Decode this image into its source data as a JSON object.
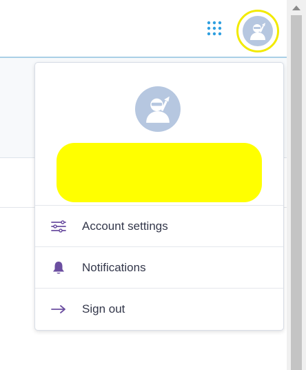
{
  "header": {
    "app_launcher_icon": "app-launcher-grid-icon",
    "avatar_icon": "user-avatar-icon"
  },
  "user_menu": {
    "avatar_icon": "user-avatar-icon",
    "menu": [
      {
        "label": "Account settings",
        "icon": "settings-list-icon"
      },
      {
        "label": "Notifications",
        "icon": "bell-icon"
      },
      {
        "label": "Sign out",
        "icon": "arrow-right-icon"
      }
    ]
  },
  "colors": {
    "accent": "#6b4ea0",
    "launcher_blue": "#2f9fe0",
    "highlight_yellow": "#f2ea00",
    "avatar_bg": "#b6c7e0",
    "header_line": "#a9cfe6"
  }
}
